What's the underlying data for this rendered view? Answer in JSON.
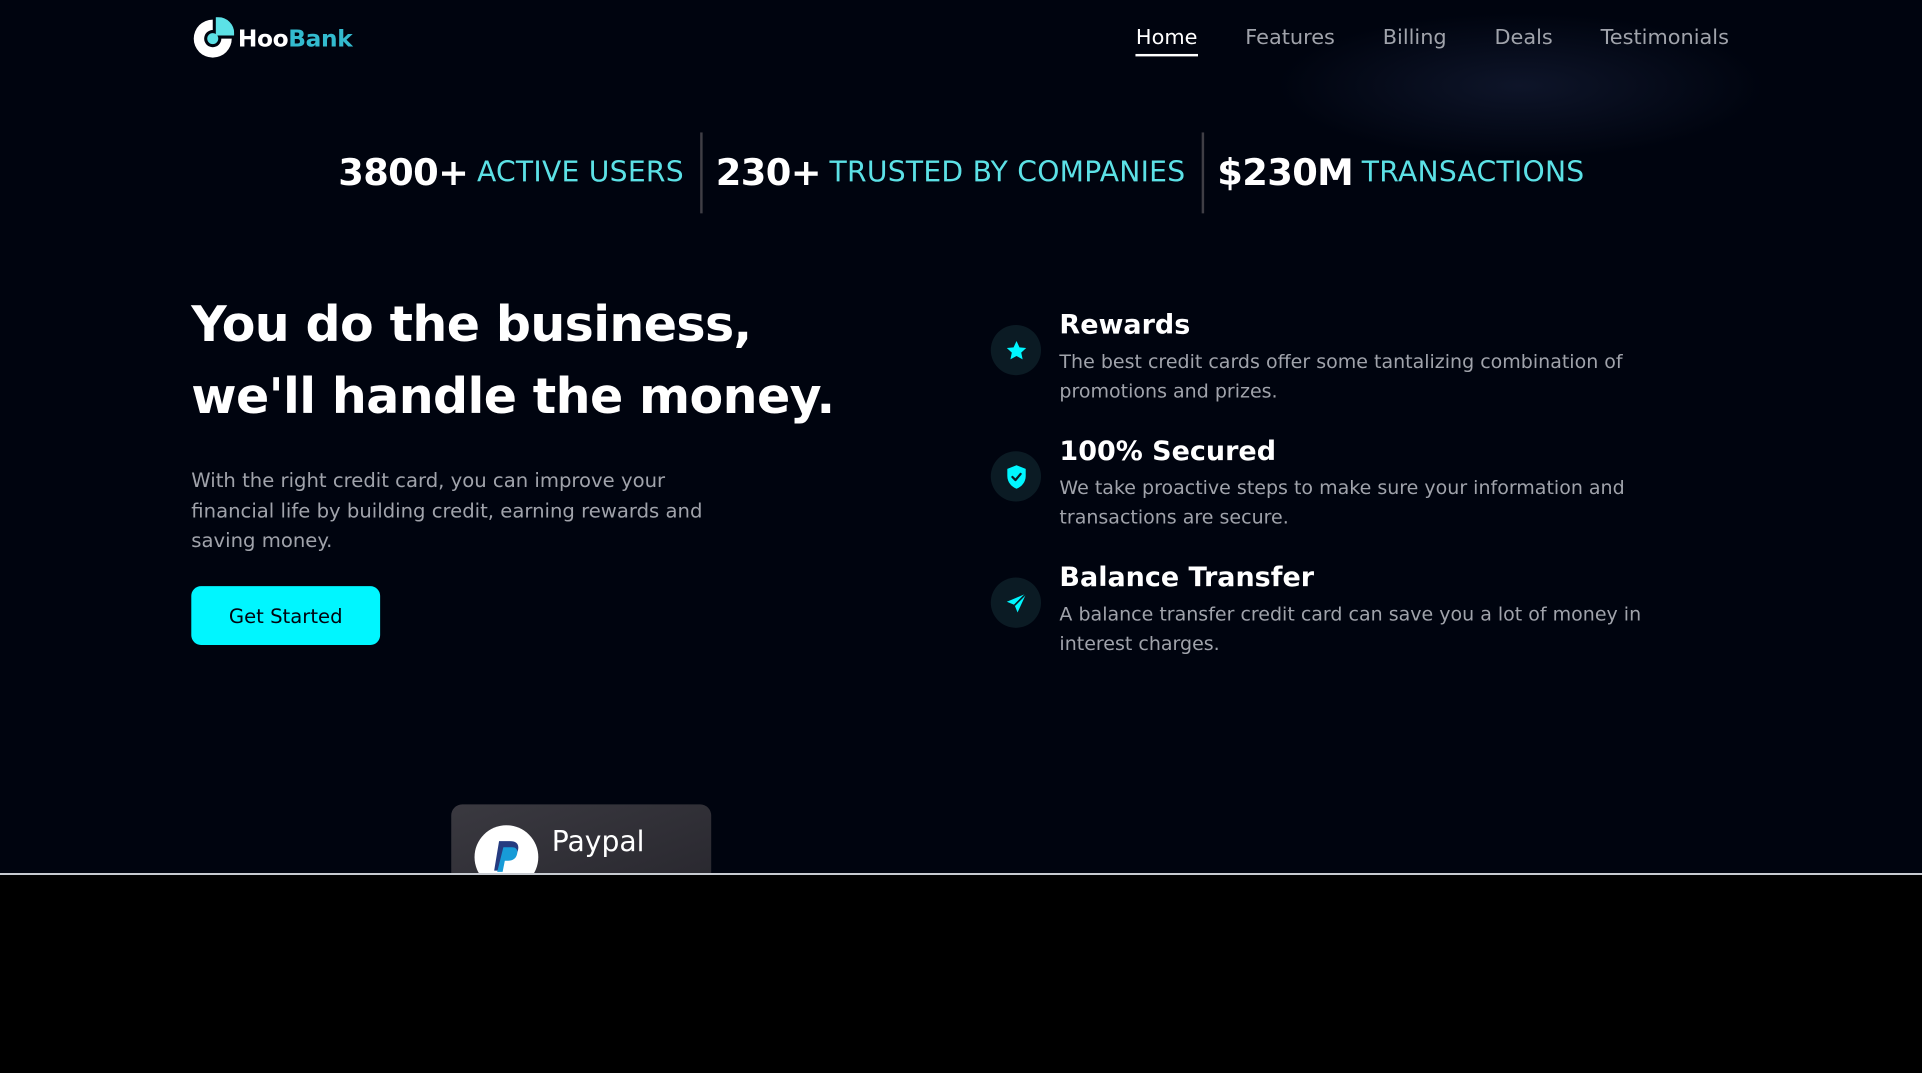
{
  "brand": {
    "name_part1": "Hoo",
    "name_part2": "Bank",
    "accent_color": "#33bbcf"
  },
  "nav": {
    "items": [
      {
        "label": "Home",
        "active": true
      },
      {
        "label": "Features",
        "active": false
      },
      {
        "label": "Billing",
        "active": false
      },
      {
        "label": "Deals",
        "active": false
      },
      {
        "label": "Testimonials",
        "active": false
      }
    ]
  },
  "stats": [
    {
      "value": "3800+",
      "label": "ACTIVE USERS"
    },
    {
      "value": "230+",
      "label": "TRUSTED BY COMPANIES"
    },
    {
      "value": "$230M",
      "label": "TRANSACTIONS"
    }
  ],
  "hero": {
    "title": "You do the business, we'll handle the money.",
    "description": "With the right credit card, you can improve your financial life by building credit, earning rewards and saving money.",
    "cta_label": "Get Started"
  },
  "features": [
    {
      "icon": "star-icon",
      "title": "Rewards",
      "description": "The best credit cards offer some tantalizing combination of promotions and prizes."
    },
    {
      "icon": "shield-icon",
      "title": "100% Secured",
      "description": "We take proactive steps to make sure your information and transactions are secure."
    },
    {
      "icon": "send-icon",
      "title": "Balance Transfer",
      "description": "A balance transfer credit card can save you a lot of money in interest charges."
    }
  ],
  "paypal_card": {
    "title": "Paypal"
  },
  "colors": {
    "background": "#00040f",
    "cta": "#00f6ff",
    "stat_label": "#5ce1e6",
    "muted_text": "#a0a3ab"
  }
}
